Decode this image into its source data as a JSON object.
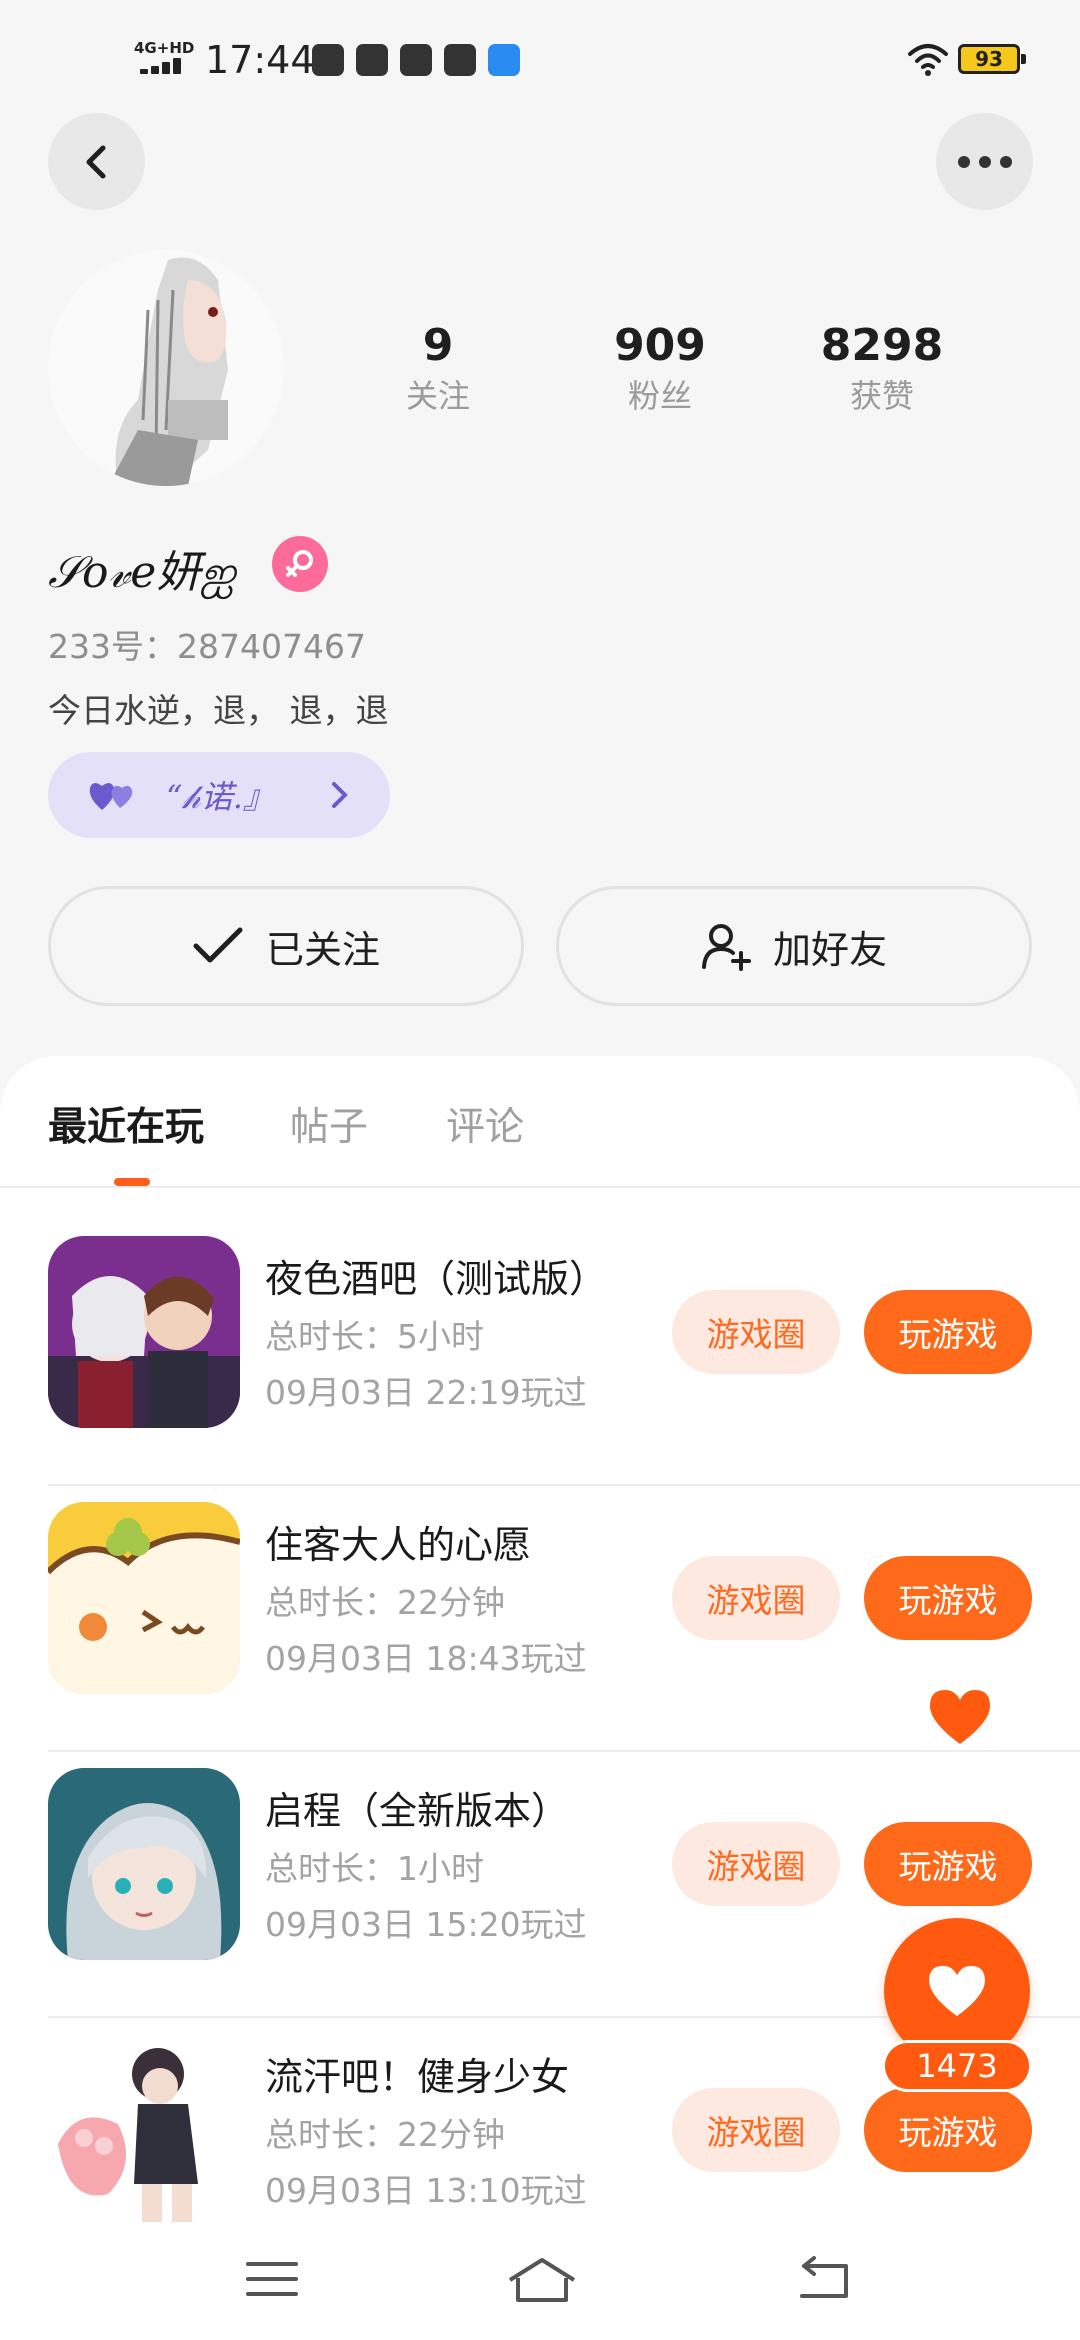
{
  "status_bar": {
    "network": "4G+HD",
    "time": "17:44",
    "battery": "93"
  },
  "profile": {
    "nickname": "𝒮𝑜𝓋𝑒妍ஐ",
    "uid": "233号：287407467",
    "bio": "今日水逆，退， 退，退",
    "tag_text": "“𝒽诺.』",
    "stats": [
      {
        "value": "9",
        "label": "关注"
      },
      {
        "value": "909",
        "label": "粉丝"
      },
      {
        "value": "8298",
        "label": "获赞"
      }
    ]
  },
  "actions": {
    "follow_label": "已关注",
    "add_friend_label": "加好友"
  },
  "tabs": [
    {
      "label": "最近在玩",
      "active": true
    },
    {
      "label": "帖子",
      "active": false
    },
    {
      "label": "评论",
      "active": false
    }
  ],
  "games": [
    {
      "title": "夜色酒吧（测试版）",
      "duration": "总时长：5小时",
      "last_played": "09月03日 22:19玩过",
      "circle_label": "游戏圈",
      "play_label": "玩游戏"
    },
    {
      "title": "住客大人的心愿",
      "duration": "总时长：22分钟",
      "last_played": "09月03日 18:43玩过",
      "circle_label": "游戏圈",
      "play_label": "玩游戏"
    },
    {
      "title": "启程（全新版本）",
      "duration": "总时长：1小时",
      "last_played": "09月03日 15:20玩过",
      "circle_label": "游戏圈",
      "play_label": "玩游戏"
    },
    {
      "title": "流汗吧！健身少女",
      "duration": "总时长：22分钟",
      "last_played": "09月03日 13:10玩过",
      "circle_label": "游戏圈",
      "play_label": "玩游戏"
    }
  ],
  "like_count": "1473",
  "colors": {
    "accent": "#ff6a1a",
    "accent_light": "#fde9df",
    "tag_bg": "#e3e0f8",
    "gender_pink": "#fd6b9b"
  }
}
